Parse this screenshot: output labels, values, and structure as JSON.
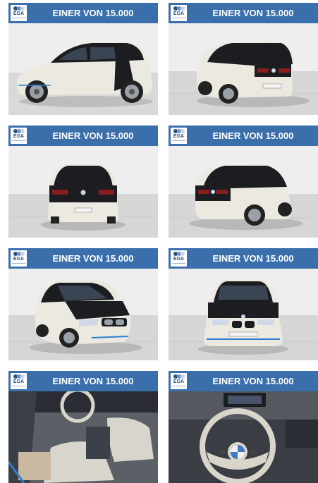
{
  "banner": {
    "logo_text": "EGA",
    "headline": "EINER VON 15.000"
  },
  "colors": {
    "banner_blue": "#3a6fac",
    "car_body": "#e9e6dd",
    "car_roof": "#16181c",
    "accent_blue": "#2e7fd0"
  },
  "gallery": [
    {
      "view": "side-profile"
    },
    {
      "view": "rear-three-quarter-right"
    },
    {
      "view": "rear"
    },
    {
      "view": "rear-three-quarter-left"
    },
    {
      "view": "front-three-quarter"
    },
    {
      "view": "front"
    },
    {
      "view": "interior-seats"
    },
    {
      "view": "interior-steering-wheel"
    }
  ]
}
